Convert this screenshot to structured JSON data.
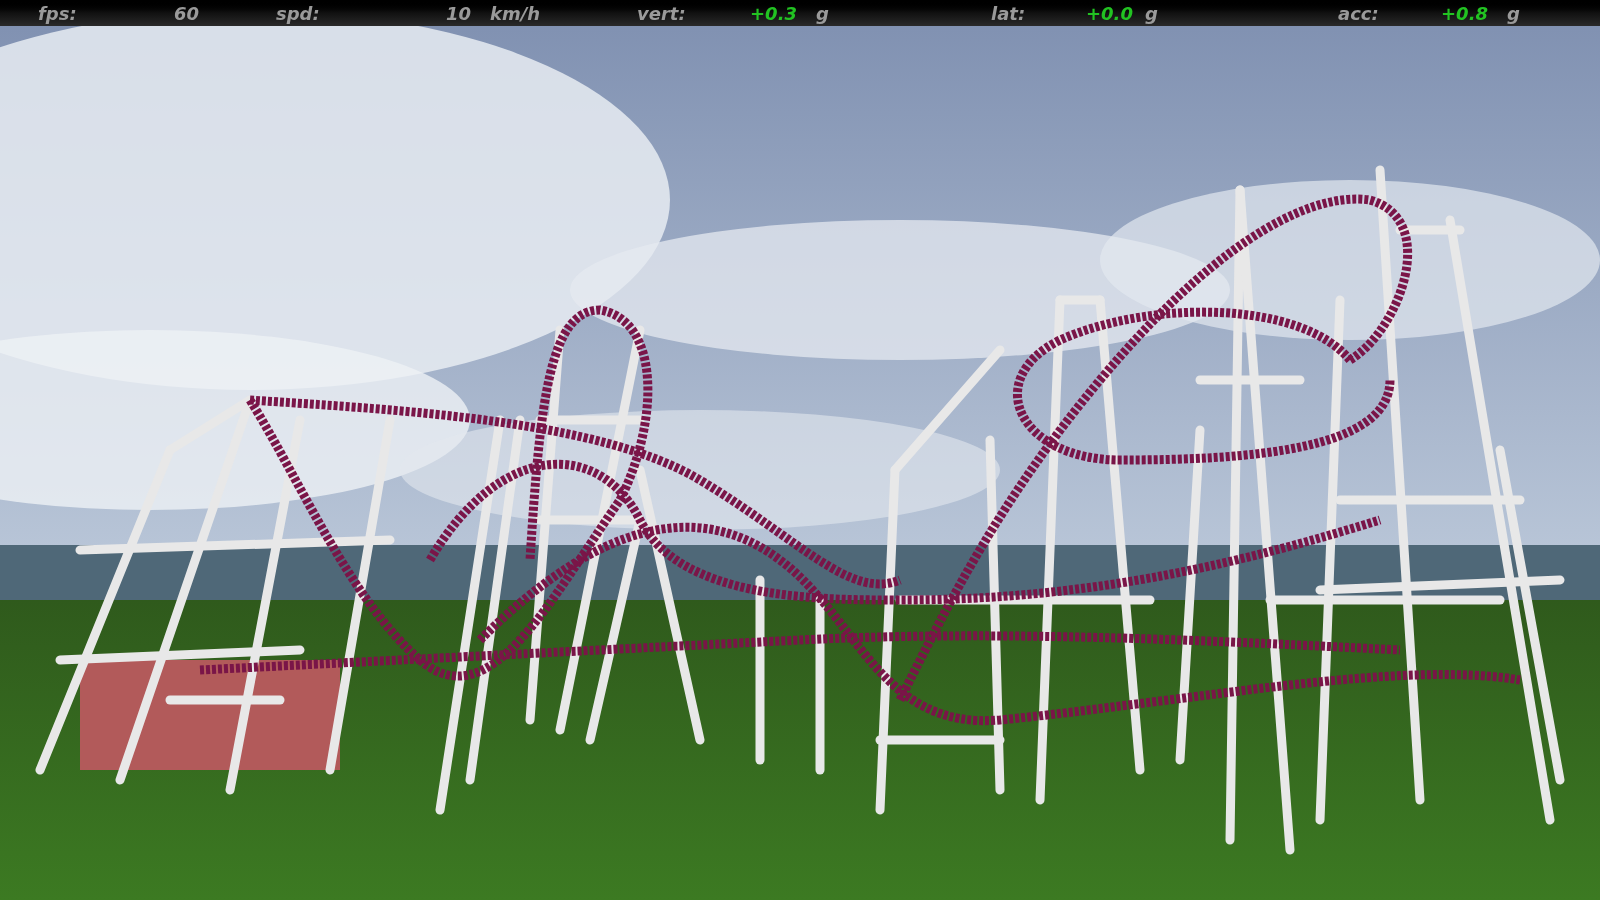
{
  "hud": {
    "readings": [
      {
        "label": "fps:",
        "value": "60",
        "color": "#9a9a9a"
      },
      {
        "label": "spd:",
        "value": "10",
        "unit": "km/h",
        "color": "#9a9a9a"
      },
      {
        "label": "vert:",
        "value": "+0.3",
        "unit": "g",
        "color": "#22c322"
      },
      {
        "label": "lat:",
        "value": "+0.0",
        "unit": "g",
        "color": "#22c322"
      },
      {
        "label": "acc:",
        "value": "+0.8",
        "unit": "g",
        "color": "#22c322"
      }
    ]
  }
}
